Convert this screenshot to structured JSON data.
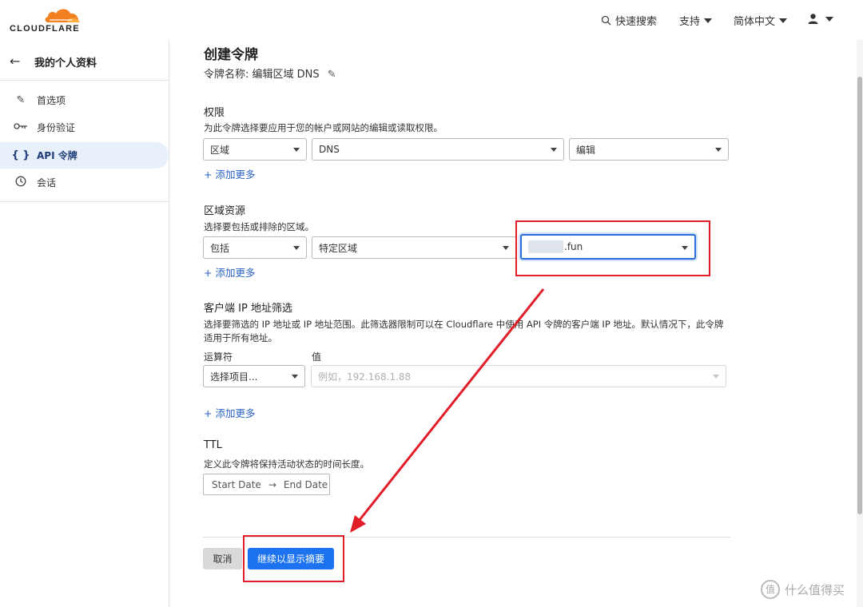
{
  "header": {
    "logo_text": "CLOUDFLARE",
    "search_label": "快速搜索",
    "support_label": "支持",
    "language_label": "简体中文"
  },
  "sidebar": {
    "title": "我的个人资料",
    "items": [
      {
        "label": "首选项",
        "icon": "pencil-icon"
      },
      {
        "label": "身份验证",
        "icon": "key-icon"
      },
      {
        "label": "API 令牌",
        "icon": "braces-icon"
      },
      {
        "label": "会话",
        "icon": "clock-icon"
      }
    ]
  },
  "main": {
    "title": "创建令牌",
    "token_name": "令牌名称: 编辑区域 DNS",
    "permissions": {
      "title": "权限",
      "desc": "为此令牌选择要应用于您的帐户或网站的编辑或读取权限。",
      "select1": "区域",
      "select2": "DNS",
      "select3": "编辑",
      "add_more": "+ 添加更多"
    },
    "zone_resources": {
      "title": "区域资源",
      "desc": "选择要包括或排除的区域。",
      "select1": "包括",
      "select2": "特定区域",
      "select3_suffix": ".fun",
      "add_more": "+ 添加更多"
    },
    "ip_filter": {
      "title": "客户端 IP 地址筛选",
      "desc_line1": "选择要筛选的 IP 地址或 IP 地址范围。此筛选器限制可以在 Cloudflare 中使用 API 令牌的客户端 IP 地址。默认情况下，此令牌",
      "desc_line2": "适用于所有地址。",
      "operator_label": "运算符",
      "value_label": "值",
      "operator_select": "选择项目...",
      "value_placeholder": "例如，192.168.1.88",
      "add_more": "+ 添加更多"
    },
    "ttl": {
      "title": "TTL",
      "desc": "定义此令牌将保持活动状态的时间长度。",
      "start": "Start Date",
      "arrow": "→",
      "end": "End Date"
    },
    "buttons": {
      "cancel": "取消",
      "continue": "继续以显示摘要"
    }
  },
  "watermark": {
    "text": "什么值得买",
    "badge": "值"
  },
  "colors": {
    "primary": "#1d72f0",
    "annotation": "#e11d2a",
    "logo_orange": "#f38020"
  }
}
